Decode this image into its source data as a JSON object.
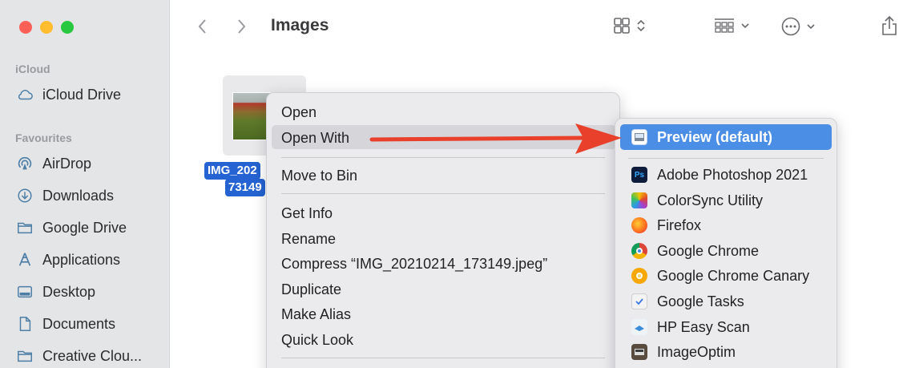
{
  "window": {
    "title": "Images"
  },
  "sidebar": {
    "sections": [
      {
        "title": "iCloud",
        "items": [
          {
            "label": "iCloud Drive",
            "icon": "cloud-icon"
          }
        ]
      },
      {
        "title": "Favourites",
        "items": [
          {
            "label": "AirDrop",
            "icon": "airdrop-icon"
          },
          {
            "label": "Downloads",
            "icon": "download-icon"
          },
          {
            "label": "Google Drive",
            "icon": "folder-icon"
          },
          {
            "label": "Applications",
            "icon": "applications-icon"
          },
          {
            "label": "Desktop",
            "icon": "desktop-icon"
          },
          {
            "label": "Documents",
            "icon": "document-icon"
          },
          {
            "label": "Creative Clou...",
            "icon": "folder-icon"
          }
        ]
      }
    ]
  },
  "file": {
    "name_line1": "IMG_202",
    "name_line2": "73149"
  },
  "context_menu": {
    "items": [
      "Open",
      "Open With",
      "Move to Bin",
      "Get Info",
      "Rename",
      "Compress “IMG_20210214_173149.jpeg”",
      "Duplicate",
      "Make Alias",
      "Quick Look"
    ]
  },
  "open_with": {
    "default": "Preview (default)",
    "apps": [
      "Adobe Photoshop 2021",
      "ColorSync Utility",
      "Firefox",
      "Google Chrome",
      "Google Chrome Canary",
      "Google Tasks",
      "HP Easy Scan",
      "ImageOptim"
    ]
  },
  "colors": {
    "highlight": "#4a8ee6",
    "arrow": "#e8402a",
    "selection": "#2463d1"
  }
}
